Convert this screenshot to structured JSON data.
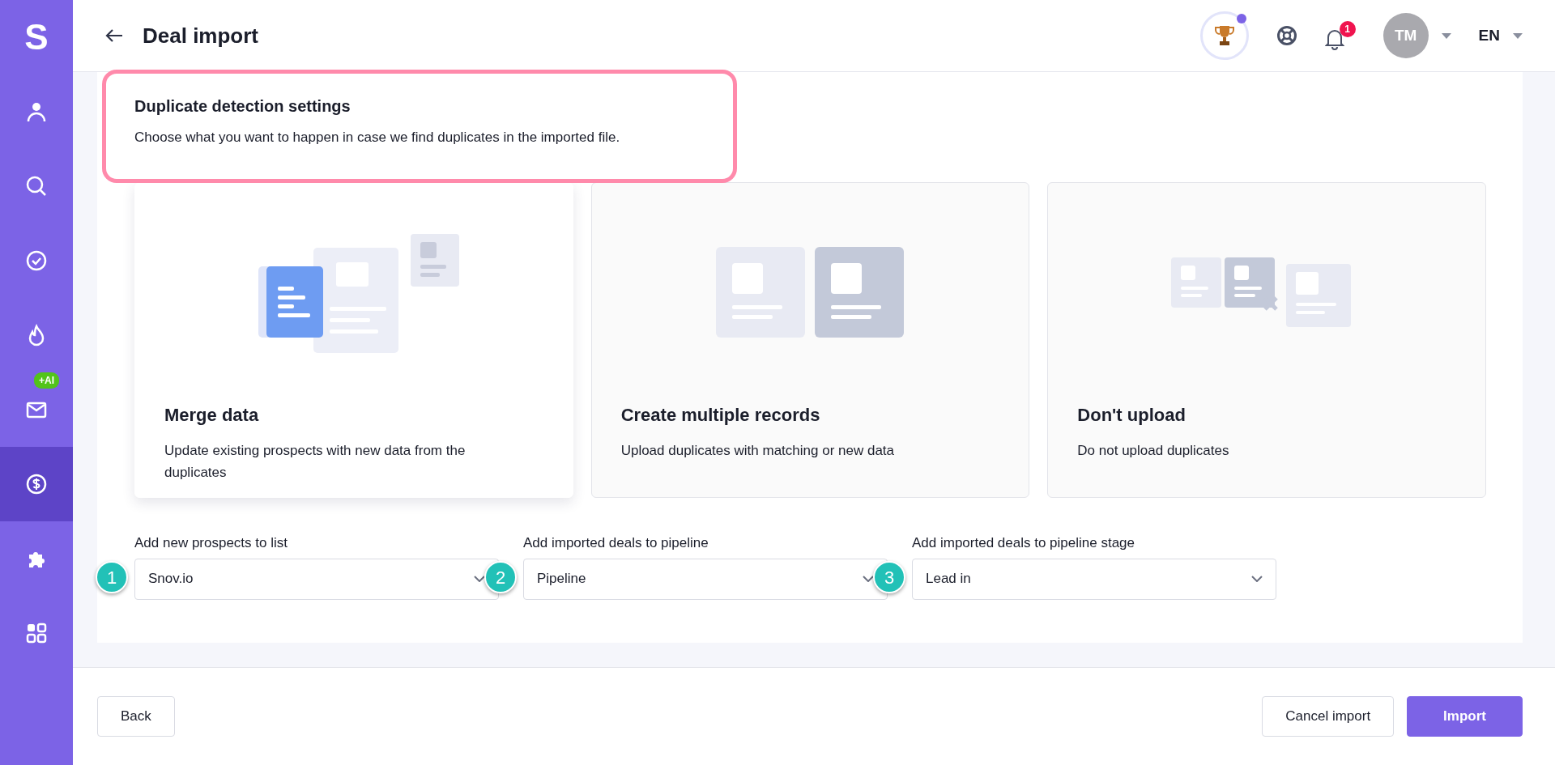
{
  "sidebar": {
    "logo": "S",
    "items": [
      {
        "kind": "person",
        "selected": false
      },
      {
        "kind": "search",
        "selected": false
      },
      {
        "kind": "check",
        "selected": false
      },
      {
        "kind": "flame",
        "selected": false
      },
      {
        "kind": "mail",
        "selected": false,
        "badge": "+AI"
      },
      {
        "kind": "dollar",
        "selected": true
      },
      {
        "kind": "puzzle",
        "selected": false
      },
      {
        "kind": "grid",
        "selected": false
      }
    ]
  },
  "header": {
    "title": "Deal import",
    "notifications": "1",
    "avatar": "TM",
    "language": "EN"
  },
  "callout": {
    "title": "Duplicate detection settings",
    "text": "Choose what you want to happen in case we find duplicates in the imported file."
  },
  "options": [
    {
      "kind": "merge",
      "title": "Merge data",
      "description": "Update existing prospects with new data from the duplicates",
      "selected": true
    },
    {
      "kind": "multiple",
      "title": "Create multiple records",
      "description": "Upload duplicates with matching or new data",
      "selected": false
    },
    {
      "kind": "skip",
      "title": "Don't upload",
      "description": "Do not upload duplicates",
      "selected": false
    }
  ],
  "selects": [
    {
      "step": "1",
      "label": "Add new prospects to list",
      "value": "Snov.io"
    },
    {
      "step": "2",
      "label": "Add imported deals to pipeline",
      "value": "Pipeline"
    },
    {
      "step": "3",
      "label": "Add imported deals to pipeline stage",
      "value": "Lead in"
    }
  ],
  "footer": {
    "back": "Back",
    "cancel": "Cancel import",
    "import": "Import"
  }
}
